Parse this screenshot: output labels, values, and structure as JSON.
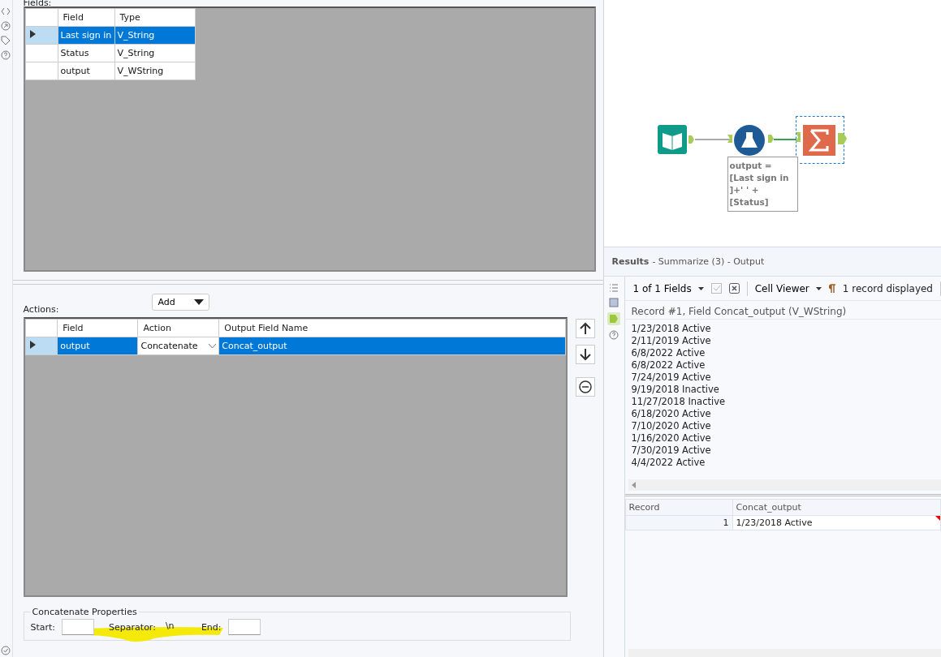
{
  "fields": {
    "label": "Fields:",
    "columns": [
      "Field",
      "Type"
    ],
    "rows": [
      {
        "field": "Last sign in",
        "type": "V_String",
        "selected": true
      },
      {
        "field": "Status",
        "type": "V_String",
        "selected": false
      },
      {
        "field": "output",
        "type": "V_WString",
        "selected": false
      }
    ]
  },
  "actions": {
    "label": "Actions:",
    "add_button": "Add",
    "columns": [
      "Field",
      "Action",
      "Output Field Name"
    ],
    "rows": [
      {
        "field": "output",
        "action": "Concatenate",
        "output_name": "Concat_output",
        "selected": true
      }
    ]
  },
  "concatenate_properties": {
    "title": "Concatenate Properties",
    "start_label": "Start:",
    "separator_label": "Separator:",
    "separator_value": "\\n",
    "end_label": "End:"
  },
  "workflow": {
    "annotation": "output = [Last sign in ]+' ' + [Status]"
  },
  "results": {
    "title": "Results",
    "subtitle": "- Summarize (3) - Output",
    "fields_selector": "1 of 1 Fields",
    "viewer": "Cell Viewer",
    "record_count": "1 record displayed",
    "cell_header": "Record #1, Field Concat_output (V_WString)",
    "cell_lines": [
      "1/23/2018 Active",
      "2/11/2019 Active",
      "6/8/2022 Active",
      "6/8/2022 Active",
      "7/24/2019 Active",
      "9/19/2018 Inactive",
      "11/27/2018 Inactive",
      "6/18/2020 Active",
      "7/10/2020 Active",
      "1/16/2020 Active",
      "7/30/2019 Active",
      "4/4/2022 Active"
    ],
    "grid": {
      "columns": [
        "Record",
        "Concat_output"
      ],
      "rows": [
        {
          "record": "1",
          "value": "1/23/2018 Active"
        }
      ]
    }
  }
}
